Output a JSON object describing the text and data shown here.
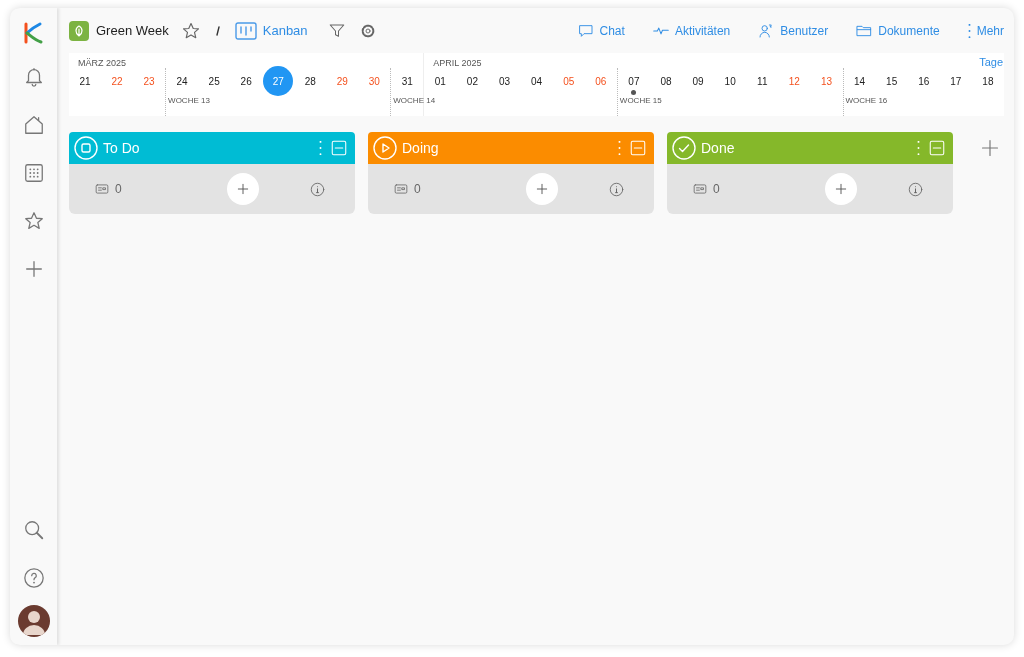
{
  "project": {
    "name": "Green Week",
    "view": "Kanban"
  },
  "nav": [
    {
      "label": "Chat",
      "kind": "chat"
    },
    {
      "label": "Aktivitäten",
      "kind": "activity"
    },
    {
      "label": "Benutzer",
      "kind": "users"
    },
    {
      "label": "Dokumente",
      "kind": "folder"
    },
    {
      "label": "Mehr",
      "kind": "more"
    }
  ],
  "calendar": {
    "unit": "Tage",
    "months": [
      {
        "label": "MÄRZ 2025",
        "days": [
          {
            "label": "21",
            "weekend": false,
            "selected": false,
            "event": false
          },
          {
            "label": "22",
            "weekend": true,
            "selected": false,
            "event": false
          },
          {
            "label": "23",
            "weekend": true,
            "selected": false,
            "event": false
          },
          {
            "label": "24",
            "weekend": false,
            "selected": false,
            "event": false,
            "week": "WOCHE 13"
          },
          {
            "label": "25",
            "weekend": false,
            "selected": false,
            "event": false
          },
          {
            "label": "26",
            "weekend": false,
            "selected": false,
            "event": false
          },
          {
            "label": "27",
            "weekend": false,
            "selected": true,
            "event": false
          },
          {
            "label": "28",
            "weekend": false,
            "selected": false,
            "event": false
          },
          {
            "label": "29",
            "weekend": true,
            "selected": false,
            "event": false
          },
          {
            "label": "30",
            "weekend": true,
            "selected": false,
            "event": false
          },
          {
            "label": "31",
            "weekend": false,
            "selected": false,
            "event": false,
            "week": "WOCHE 14"
          }
        ]
      },
      {
        "label": "APRIL 2025",
        "days": [
          {
            "label": "01",
            "weekend": false,
            "selected": false,
            "event": false
          },
          {
            "label": "02",
            "weekend": false,
            "selected": false,
            "event": false
          },
          {
            "label": "03",
            "weekend": false,
            "selected": false,
            "event": false
          },
          {
            "label": "04",
            "weekend": false,
            "selected": false,
            "event": false
          },
          {
            "label": "05",
            "weekend": true,
            "selected": false,
            "event": false
          },
          {
            "label": "06",
            "weekend": true,
            "selected": false,
            "event": false
          },
          {
            "label": "07",
            "weekend": false,
            "selected": false,
            "event": true,
            "week": "WOCHE 15"
          },
          {
            "label": "08",
            "weekend": false,
            "selected": false,
            "event": false
          },
          {
            "label": "09",
            "weekend": false,
            "selected": false,
            "event": false
          },
          {
            "label": "10",
            "weekend": false,
            "selected": false,
            "event": false
          },
          {
            "label": "11",
            "weekend": false,
            "selected": false,
            "event": false
          },
          {
            "label": "12",
            "weekend": true,
            "selected": false,
            "event": false
          },
          {
            "label": "13",
            "weekend": true,
            "selected": false,
            "event": false
          },
          {
            "label": "14",
            "weekend": false,
            "selected": false,
            "event": false,
            "week": "WOCHE 16"
          },
          {
            "label": "15",
            "weekend": false,
            "selected": false,
            "event": false
          },
          {
            "label": "16",
            "weekend": false,
            "selected": false,
            "event": false
          },
          {
            "label": "17",
            "weekend": false,
            "selected": false,
            "event": false
          },
          {
            "label": "18",
            "weekend": false,
            "selected": false,
            "event": false
          }
        ]
      }
    ]
  },
  "columns": [
    {
      "title": "To Do",
      "kind": "todo",
      "color": "#00bcd4",
      "count": "0"
    },
    {
      "title": "Doing",
      "kind": "doing",
      "color": "#fb8c00",
      "count": "0"
    },
    {
      "title": "Done",
      "kind": "done",
      "color": "#85b82a",
      "count": "0"
    }
  ]
}
